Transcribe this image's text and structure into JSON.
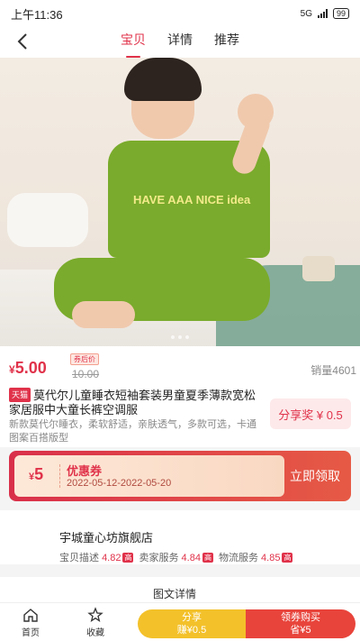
{
  "status": {
    "time": "上午11:36",
    "network": "5G",
    "battery": "99"
  },
  "nav": {
    "tabs": [
      {
        "label": "宝贝"
      },
      {
        "label": "详情"
      },
      {
        "label": "推荐"
      }
    ]
  },
  "product": {
    "currency": "¥",
    "price": "5.00",
    "coupon_tag": "券后价",
    "original_price": "10.00",
    "sales": "销量4601",
    "platform_badge": "天猫",
    "title": "莫代尔儿童睡衣短袖套装男童夏季薄款宽松家居服中大童长裤空调服",
    "description": "新款莫代尔睡衣，柔软舒适，亲肤透气，多款可选，卡通图案百搭版型",
    "shirt_print": "HAVE AAA NICE idea"
  },
  "share": {
    "label": "分享奖 ¥ 0.5"
  },
  "coupon": {
    "currency": "¥",
    "amount": "5",
    "name": "优惠券",
    "date_range": "2022-05-12-2022-05-20",
    "claim_label": "立即领取"
  },
  "shop": {
    "name": "宇城童心坊旗舰店",
    "scores": [
      {
        "label": "宝贝描述",
        "value": "4.82",
        "tag": "高"
      },
      {
        "label": "卖家服务",
        "value": "4.84",
        "tag": "高"
      },
      {
        "label": "物流服务",
        "value": "4.85",
        "tag": "高"
      }
    ]
  },
  "detail": {
    "label": "图文详情"
  },
  "bottom_bar": {
    "home_label": "首页",
    "favorite_label": "收藏",
    "share_earn_label": "分享",
    "share_earn_sub": "赚¥0.5",
    "buy_label": "领券购买",
    "buy_sub": "省¥5"
  },
  "colors": {
    "accent": "#e0324a",
    "buy": "#e8443b",
    "share": "#f3c12a"
  }
}
